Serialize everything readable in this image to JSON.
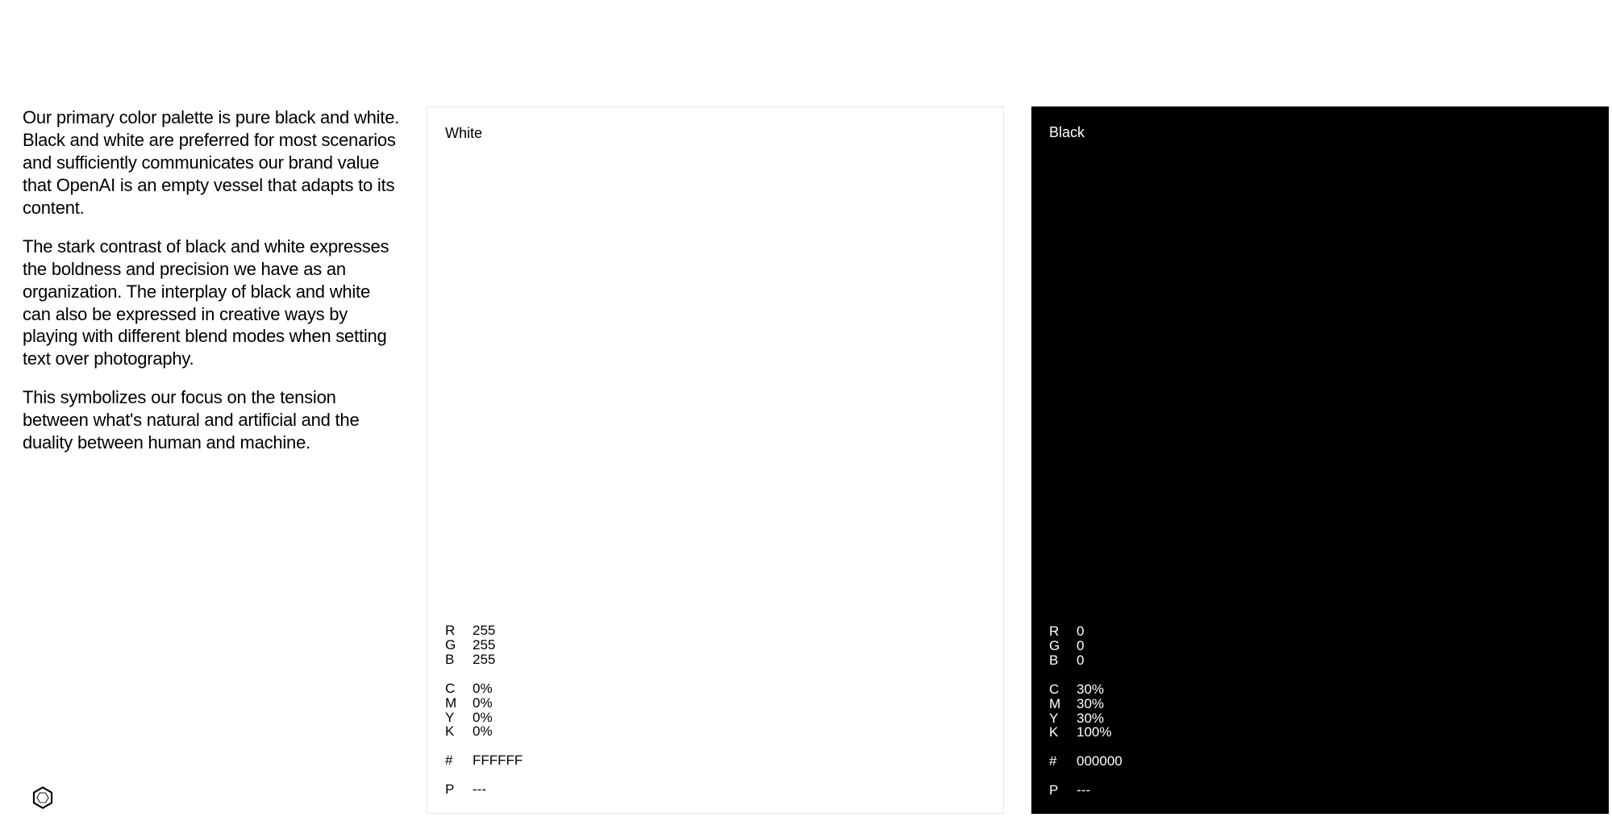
{
  "text": {
    "p1": "Our primary color palette is pure black and white. Black and white are preferred for most scenarios and sufficiently communicates our brand value that OpenAI is an empty vessel that adapts to its content.",
    "p2": "The stark contrast of black and white expresses the boldness and precision we have as an organization. The interplay of black and white can also be expressed in creative ways by playing with different blend modes when setting text over photography.",
    "p3": "This symbolizes our focus on the tension between what's natural and artificial and the duality between human and machine."
  },
  "swatches": {
    "white": {
      "name": "White",
      "rgb": {
        "R": "255",
        "G": "255",
        "B": "255"
      },
      "cmyk": {
        "C": "0%",
        "M": "0%",
        "Y": "0%",
        "K": "0%"
      },
      "hex": "FFFFFF",
      "pantone": "---",
      "bg": "#ffffff",
      "fg": "#000000"
    },
    "black": {
      "name": "Black",
      "rgb": {
        "R": "0",
        "G": "0",
        "B": "0"
      },
      "cmyk": {
        "C": "30%",
        "M": "30%",
        "Y": "30%",
        "K": "100%"
      },
      "hex": "000000",
      "pantone": "---",
      "bg": "#000000",
      "fg": "#ffffff"
    }
  },
  "labels": {
    "R": "R",
    "G": "G",
    "B": "B",
    "C": "C",
    "M": "M",
    "Y": "Y",
    "K": "K",
    "hash": "#",
    "P": "P"
  }
}
